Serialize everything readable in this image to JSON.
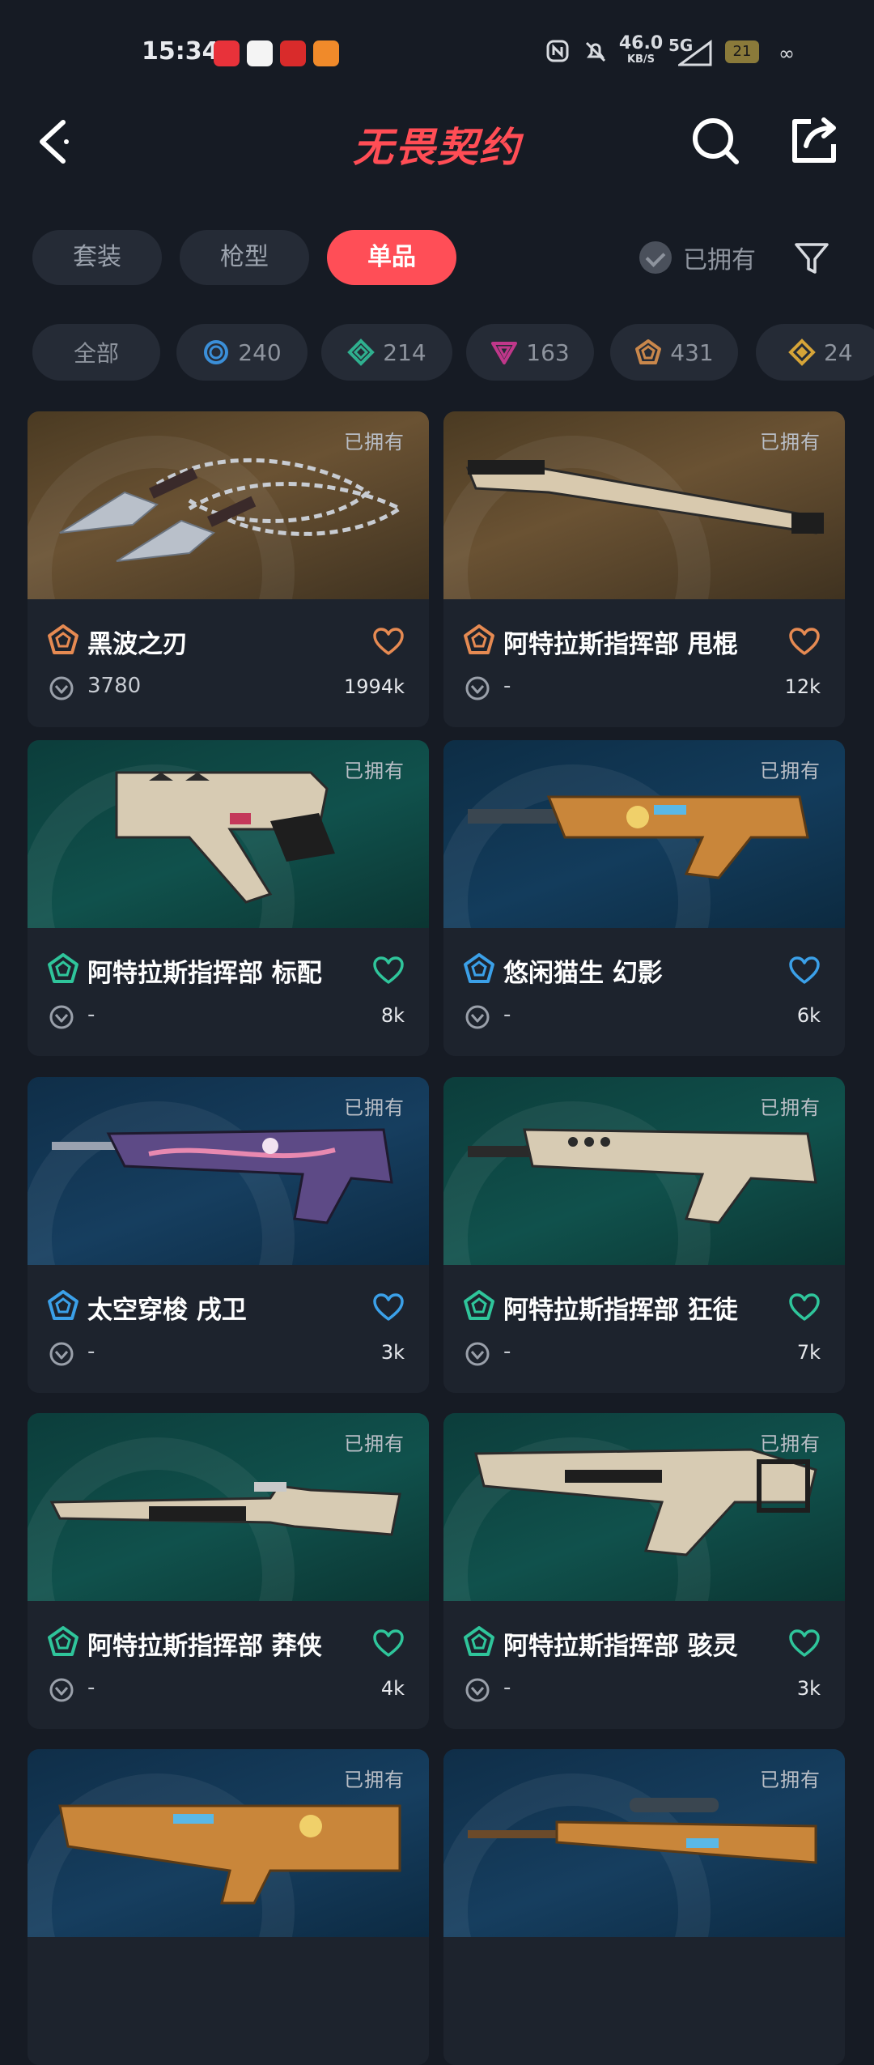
{
  "status_bar": {
    "time": "15:34",
    "speed": "46.0",
    "speed_unit": "KB/S",
    "network": "5G",
    "battery": "21"
  },
  "header": {
    "brand": "无畏契约",
    "back_icon": "back-icon",
    "search_icon": "search-icon",
    "share_icon": "share-icon"
  },
  "tabs": [
    {
      "label": "套装",
      "active": false
    },
    {
      "label": "枪型",
      "active": false
    },
    {
      "label": "单品",
      "active": true
    }
  ],
  "owned_filter": {
    "label": "已拥有"
  },
  "tier_chips": [
    {
      "label": "全部"
    },
    {
      "count": "240",
      "tier_color": "#3b8fd8"
    },
    {
      "count": "214",
      "tier_color": "#2fb08f"
    },
    {
      "count": "163",
      "tier_color": "#c0378a"
    },
    {
      "count": "431",
      "tier_color": "#c9874b"
    },
    {
      "count": "24",
      "tier_color": "#d6a438"
    }
  ],
  "items": [
    {
      "owned": "已拥有",
      "name": "黑波之刃",
      "price": "3780",
      "likes": "1994k",
      "tier_color": "#e68a52",
      "heart_color": "#e68a52",
      "bg": "gold",
      "art": "kunai"
    },
    {
      "owned": "已拥有",
      "name": "阿特拉斯指挥部 甩棍",
      "price": "-",
      "likes": "12k",
      "tier_color": "#e68a52",
      "heart_color": "#e68a52",
      "bg": "gold",
      "art": "baton"
    },
    {
      "owned": "已拥有",
      "name": "阿特拉斯指挥部 标配",
      "price": "-",
      "likes": "8k",
      "tier_color": "#2fc59b",
      "heart_color": "#2fc59b",
      "bg": "teal",
      "art": "pistol"
    },
    {
      "owned": "已拥有",
      "name": "悠闲猫生 幻影",
      "price": "-",
      "likes": "6k",
      "tier_color": "#3ba0e8",
      "heart_color": "#3ba0e8",
      "bg": "blue",
      "art": "rifle-cat"
    },
    {
      "owned": "已拥有",
      "name": "太空穿梭 戌卫",
      "price": "-",
      "likes": "3k",
      "tier_color": "#3ba0e8",
      "heart_color": "#3ba0e8",
      "bg": "navy",
      "art": "rifle-space"
    },
    {
      "owned": "已拥有",
      "name": "阿特拉斯指挥部 狂徒",
      "price": "-",
      "likes": "7k",
      "tier_color": "#2fc59b",
      "heart_color": "#2fc59b",
      "bg": "teal",
      "art": "rifle-atlas"
    },
    {
      "owned": "已拥有",
      "name": "阿特拉斯指挥部 莽侠",
      "price": "-",
      "likes": "4k",
      "tier_color": "#2fc59b",
      "heart_color": "#2fc59b",
      "bg": "teal",
      "art": "shotgun"
    },
    {
      "owned": "已拥有",
      "name": "阿特拉斯指挥部 骇灵",
      "price": "-",
      "likes": "3k",
      "tier_color": "#2fc59b",
      "heart_color": "#2fc59b",
      "bg": "teal",
      "art": "smg"
    },
    {
      "owned": "已拥有",
      "name": "",
      "price": "",
      "likes": "",
      "tier_color": "#3ba0e8",
      "heart_color": "#3ba0e8",
      "bg": "navy",
      "art": "bullpup-cat"
    },
    {
      "owned": "已拥有",
      "name": "",
      "price": "",
      "likes": "",
      "tier_color": "#3ba0e8",
      "heart_color": "#3ba0e8",
      "bg": "navy",
      "art": "sniper-cat"
    }
  ]
}
